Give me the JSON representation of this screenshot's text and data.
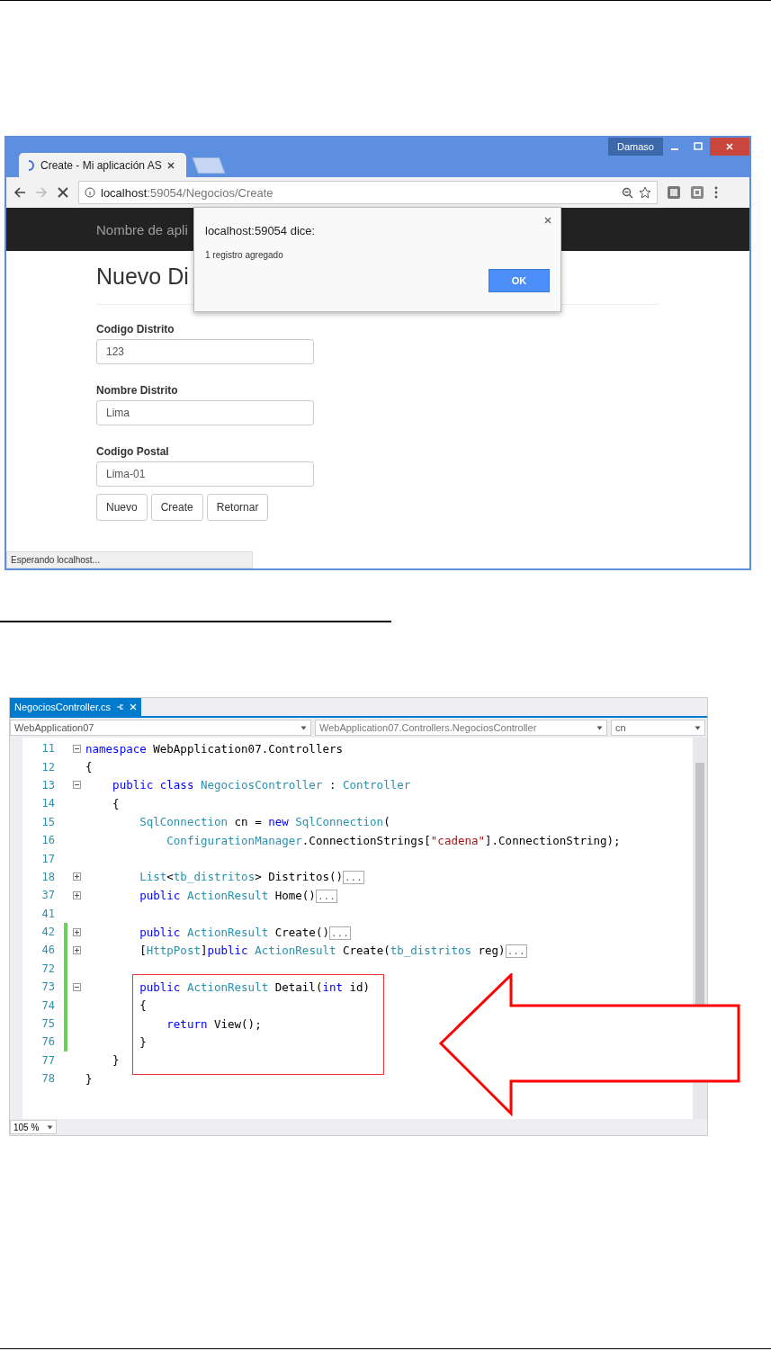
{
  "browser": {
    "tab_title": "Create - Mi aplicación AS",
    "user": "Damaso",
    "url_host": "localhost",
    "url_rest": ":59054/Negocios/Create",
    "navbar_brand": "Nombre de apli",
    "heading": "Nuevo Di",
    "fields": [
      {
        "label": "Codigo Distrito",
        "value": "123"
      },
      {
        "label": "Nombre Distrito",
        "value": "Lima"
      },
      {
        "label": "Codigo Postal",
        "value": "Lima-01"
      }
    ],
    "buttons": [
      "Nuevo",
      "Create",
      "Retornar"
    ],
    "status": "Esperando localhost...",
    "dialog": {
      "title": "localhost:59054 dice:",
      "message": "1 registro agregado",
      "ok": "OK"
    }
  },
  "editor": {
    "file_tab": "NegociosController.cs",
    "project": "WebApplication07",
    "class_path": "WebApplication07.Controllers.NegociosController",
    "member": "cn",
    "zoom": "105 %",
    "lines": [
      {
        "number": "11",
        "folded": false,
        "changed": false,
        "tokens": [
          {
            "kind": "kw",
            "text": "namespace"
          },
          {
            "kind": "plain",
            "text": " WebApplication07.Controllers"
          }
        ]
      },
      {
        "number": "12",
        "changed": false,
        "tokens": [
          {
            "kind": "plain",
            "text": "{"
          }
        ]
      },
      {
        "number": "13",
        "folded": false,
        "changed": false,
        "tokens": [
          {
            "kind": "kw",
            "text": "    public class "
          },
          {
            "kind": "type",
            "text": "NegociosController"
          },
          {
            "kind": "plain",
            "text": " : "
          },
          {
            "kind": "type",
            "text": "Controller"
          }
        ]
      },
      {
        "number": "14",
        "changed": false,
        "tokens": [
          {
            "kind": "plain",
            "text": "    {"
          }
        ]
      },
      {
        "number": "15",
        "changed": false,
        "tokens": [
          {
            "kind": "type",
            "text": "        SqlConnection"
          },
          {
            "kind": "plain",
            "text": " cn = "
          },
          {
            "kind": "kw",
            "text": "new "
          },
          {
            "kind": "type",
            "text": "SqlConnection"
          },
          {
            "kind": "plain",
            "text": "("
          }
        ]
      },
      {
        "number": "16",
        "changed": false,
        "tokens": [
          {
            "kind": "type",
            "text": "            ConfigurationManager"
          },
          {
            "kind": "plain",
            "text": ".ConnectionStrings["
          },
          {
            "kind": "str",
            "text": "\"cadena\""
          },
          {
            "kind": "plain",
            "text": "].ConnectionString);"
          }
        ]
      },
      {
        "number": "17",
        "changed": false
      },
      {
        "number": "18",
        "folded": true,
        "changed": false,
        "tokens": [
          {
            "kind": "type",
            "text": "        List"
          },
          {
            "kind": "plain",
            "text": "<"
          },
          {
            "kind": "type",
            "text": "tb_distritos"
          },
          {
            "kind": "plain",
            "text": "> Distritos()"
          },
          {
            "kind": "collapsed",
            "text": "..."
          }
        ]
      },
      {
        "number": "37",
        "folded": true,
        "changed": false,
        "tokens": [
          {
            "kind": "kw",
            "text": "        public "
          },
          {
            "kind": "type",
            "text": "ActionResult"
          },
          {
            "kind": "plain",
            "text": " Home()"
          },
          {
            "kind": "collapsed",
            "text": "..."
          }
        ]
      },
      {
        "number": "41",
        "changed": false
      },
      {
        "number": "42",
        "folded": true,
        "changed": true,
        "tokens": [
          {
            "kind": "kw",
            "text": "        public "
          },
          {
            "kind": "type",
            "text": "ActionResult"
          },
          {
            "kind": "plain",
            "text": " Create()"
          },
          {
            "kind": "collapsed",
            "text": "..."
          }
        ]
      },
      {
        "number": "46",
        "folded": true,
        "changed": true,
        "tokens": [
          {
            "kind": "plain",
            "text": "        ["
          },
          {
            "kind": "type",
            "text": "HttpPost"
          },
          {
            "kind": "plain",
            "text": "]"
          },
          {
            "kind": "kw",
            "text": "public "
          },
          {
            "kind": "type",
            "text": "ActionResult"
          },
          {
            "kind": "plain",
            "text": " Create("
          },
          {
            "kind": "type",
            "text": "tb_distritos"
          },
          {
            "kind": "plain",
            "text": " reg)"
          },
          {
            "kind": "collapsed",
            "text": "..."
          }
        ]
      },
      {
        "number": "72",
        "changed": true
      },
      {
        "number": "73",
        "folded": false,
        "changed": true,
        "tokens": [
          {
            "kind": "kw",
            "text": "        public "
          },
          {
            "kind": "type",
            "text": "ActionResult"
          },
          {
            "kind": "plain",
            "text": " Detail("
          },
          {
            "kind": "kw",
            "text": "int"
          },
          {
            "kind": "plain",
            "text": " id)"
          }
        ]
      },
      {
        "number": "74",
        "changed": true,
        "tokens": [
          {
            "kind": "plain",
            "text": "        {"
          }
        ]
      },
      {
        "number": "75",
        "changed": true,
        "tokens": [
          {
            "kind": "kw",
            "text": "            return"
          },
          {
            "kind": "plain",
            "text": " View();"
          }
        ]
      },
      {
        "number": "76",
        "changed": true,
        "tokens": [
          {
            "kind": "plain",
            "text": "        }"
          }
        ]
      },
      {
        "number": "77",
        "changed": false,
        "tokens": [
          {
            "kind": "plain",
            "text": "    }"
          }
        ]
      },
      {
        "number": "78",
        "changed": false,
        "tokens": [
          {
            "kind": "plain",
            "text": "}"
          }
        ]
      }
    ]
  }
}
